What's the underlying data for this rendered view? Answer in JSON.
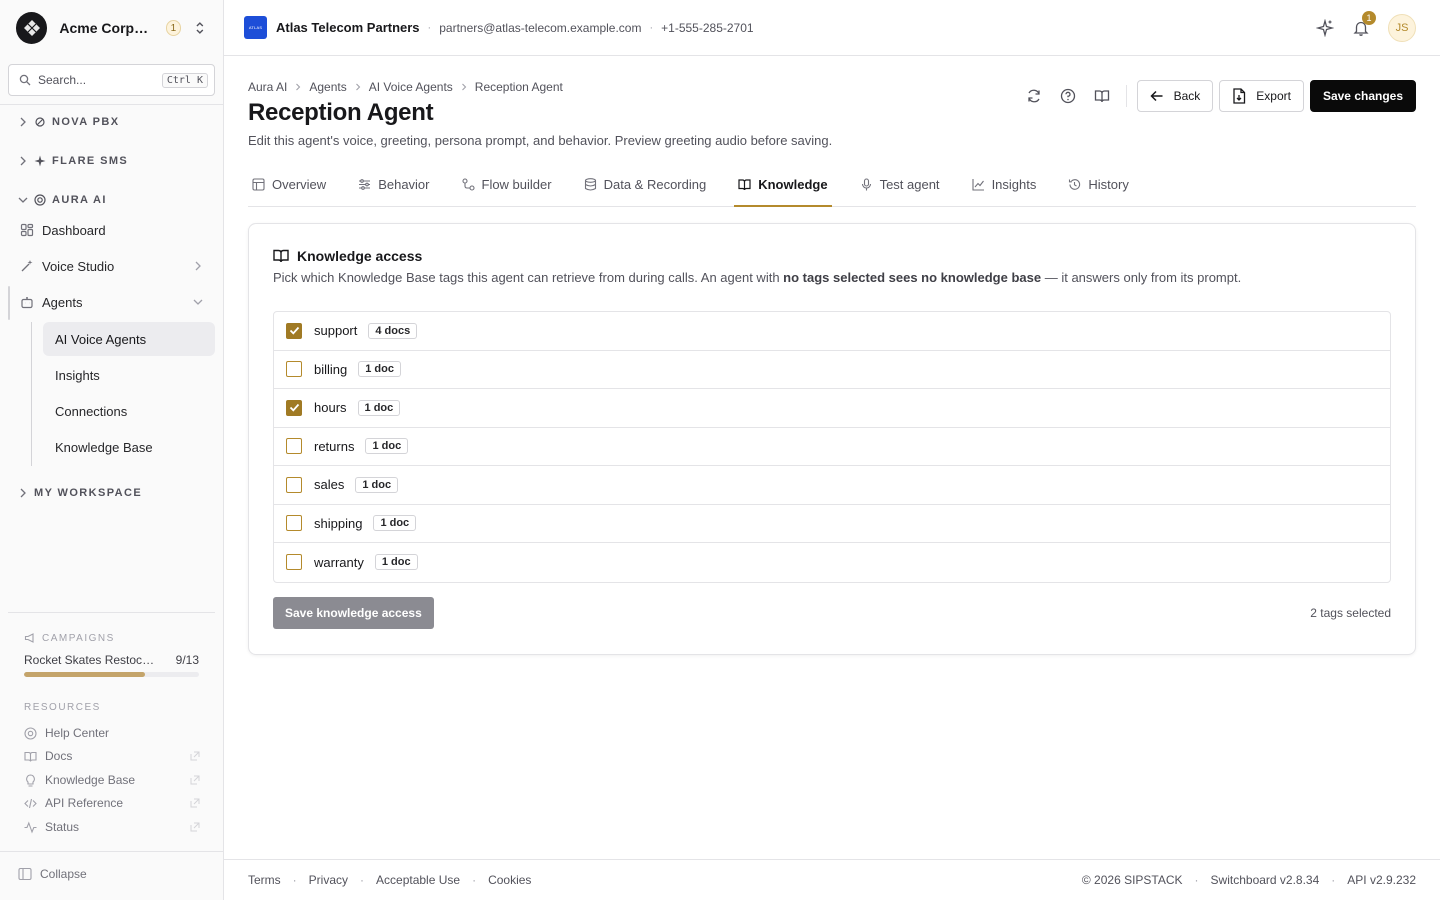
{
  "org": {
    "name": "Acme Corporation",
    "badge": "1"
  },
  "search": {
    "placeholder": "Search...",
    "shortcut": "Ctrl K"
  },
  "sidebar": {
    "groups": [
      {
        "label": "NOVA PBX"
      },
      {
        "label": "FLARE SMS"
      },
      {
        "label": "AURA AI"
      },
      {
        "label": "MY WORKSPACE"
      }
    ],
    "items": [
      {
        "label": "Dashboard"
      },
      {
        "label": "Voice Studio"
      },
      {
        "label": "Agents"
      }
    ],
    "sub_items": [
      {
        "label": "AI Voice Agents"
      },
      {
        "label": "Insights"
      },
      {
        "label": "Connections"
      },
      {
        "label": "Knowledge Base"
      }
    ],
    "campaigns_label": "CAMPAIGNS",
    "campaign": {
      "name": "Rocket Skates Restock Blast",
      "progress_text": "9/13",
      "progress": 0.69
    },
    "resources_label": "RESOURCES",
    "resources": [
      {
        "label": "Help Center"
      },
      {
        "label": "Docs"
      },
      {
        "label": "Knowledge Base"
      },
      {
        "label": "API Reference"
      },
      {
        "label": "Status"
      }
    ],
    "collapse_label": "Collapse"
  },
  "topbar": {
    "logo_text": "ATLAS",
    "tenant": "Atlas Telecom Partners",
    "email": "partners@atlas-telecom.example.com",
    "phone": "+1-555-285-2701",
    "notifications": "1",
    "avatar": "JS"
  },
  "breadcrumb": [
    "Aura AI",
    "Agents",
    "AI Voice Agents",
    "Reception Agent"
  ],
  "page": {
    "title": "Reception Agent",
    "subtitle": "Edit this agent's voice, greeting, persona prompt, and behavior. Preview greeting audio before saving."
  },
  "actions": {
    "back": "Back",
    "export": "Export",
    "save": "Save changes"
  },
  "tabs": [
    {
      "label": "Overview"
    },
    {
      "label": "Behavior"
    },
    {
      "label": "Flow builder"
    },
    {
      "label": "Data & Recording"
    },
    {
      "label": "Knowledge"
    },
    {
      "label": "Test agent"
    },
    {
      "label": "Insights"
    },
    {
      "label": "History"
    }
  ],
  "knowledge": {
    "title": "Knowledge access",
    "desc_prefix": "Pick which Knowledge Base tags this agent can retrieve from during calls. An agent with ",
    "desc_bold": "no tags selected sees no knowledge base",
    "desc_suffix": " — it answers only from its prompt.",
    "tags": [
      {
        "name": "support",
        "count": "4 docs",
        "checked": true
      },
      {
        "name": "billing",
        "count": "1 doc",
        "checked": false
      },
      {
        "name": "hours",
        "count": "1 doc",
        "checked": true
      },
      {
        "name": "returns",
        "count": "1 doc",
        "checked": false
      },
      {
        "name": "sales",
        "count": "1 doc",
        "checked": false
      },
      {
        "name": "shipping",
        "count": "1 doc",
        "checked": false
      },
      {
        "name": "warranty",
        "count": "1 doc",
        "checked": false
      }
    ],
    "save_label": "Save knowledge access",
    "selected_text": "2 tags selected"
  },
  "footer": {
    "links": [
      "Terms",
      "Privacy",
      "Acceptable Use",
      "Cookies"
    ],
    "copyright": "© 2026 SIPSTACK",
    "switchboard": "Switchboard v2.8.34",
    "api": "API v2.9.232"
  },
  "colors": {
    "accent": "#b48a2c",
    "primary": "#0a0a0a",
    "tenant_logo": "#1d4ed8"
  }
}
